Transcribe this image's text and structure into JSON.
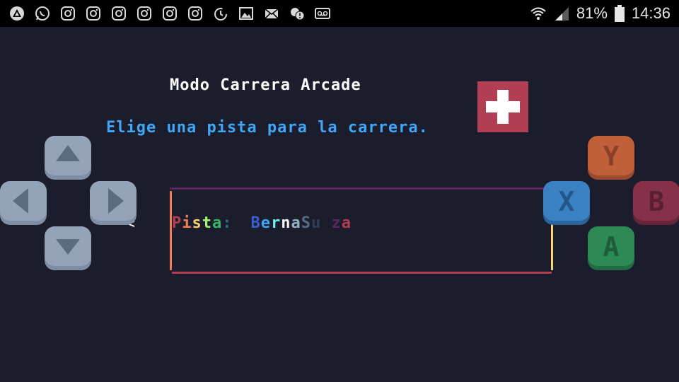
{
  "status_bar": {
    "left_icons": [
      "affinity-icon",
      "whatsapp-icon",
      "instagram-icon",
      "instagram-icon",
      "instagram-icon",
      "instagram-icon",
      "instagram-icon",
      "instagram-icon",
      "sync-icon",
      "gallery-icon",
      "mail-icon",
      "chat-alert-icon",
      "voicemail-icon"
    ],
    "battery": "81%",
    "time": "14:36"
  },
  "game": {
    "title": "Modo Carrera Arcade",
    "instructions": "Elige una pista para la carrera.",
    "selector": {
      "label": "Pista:",
      "value": "Berna Suiza",
      "prev_arrow": "<"
    }
  },
  "controls": {
    "y_label": "Y",
    "x_label": "X",
    "b_label": "B",
    "a_label": "A"
  },
  "colors": {
    "background": "#1b1d2d",
    "title": "#ffffff",
    "instructions": "#41a6f6",
    "flag_red": "#b13e53",
    "dpad": "#94a4b8",
    "btn_y": "#c0603a",
    "btn_x": "#3b82c4",
    "btn_b": "#86304a",
    "btn_a": "#2e8a55"
  }
}
